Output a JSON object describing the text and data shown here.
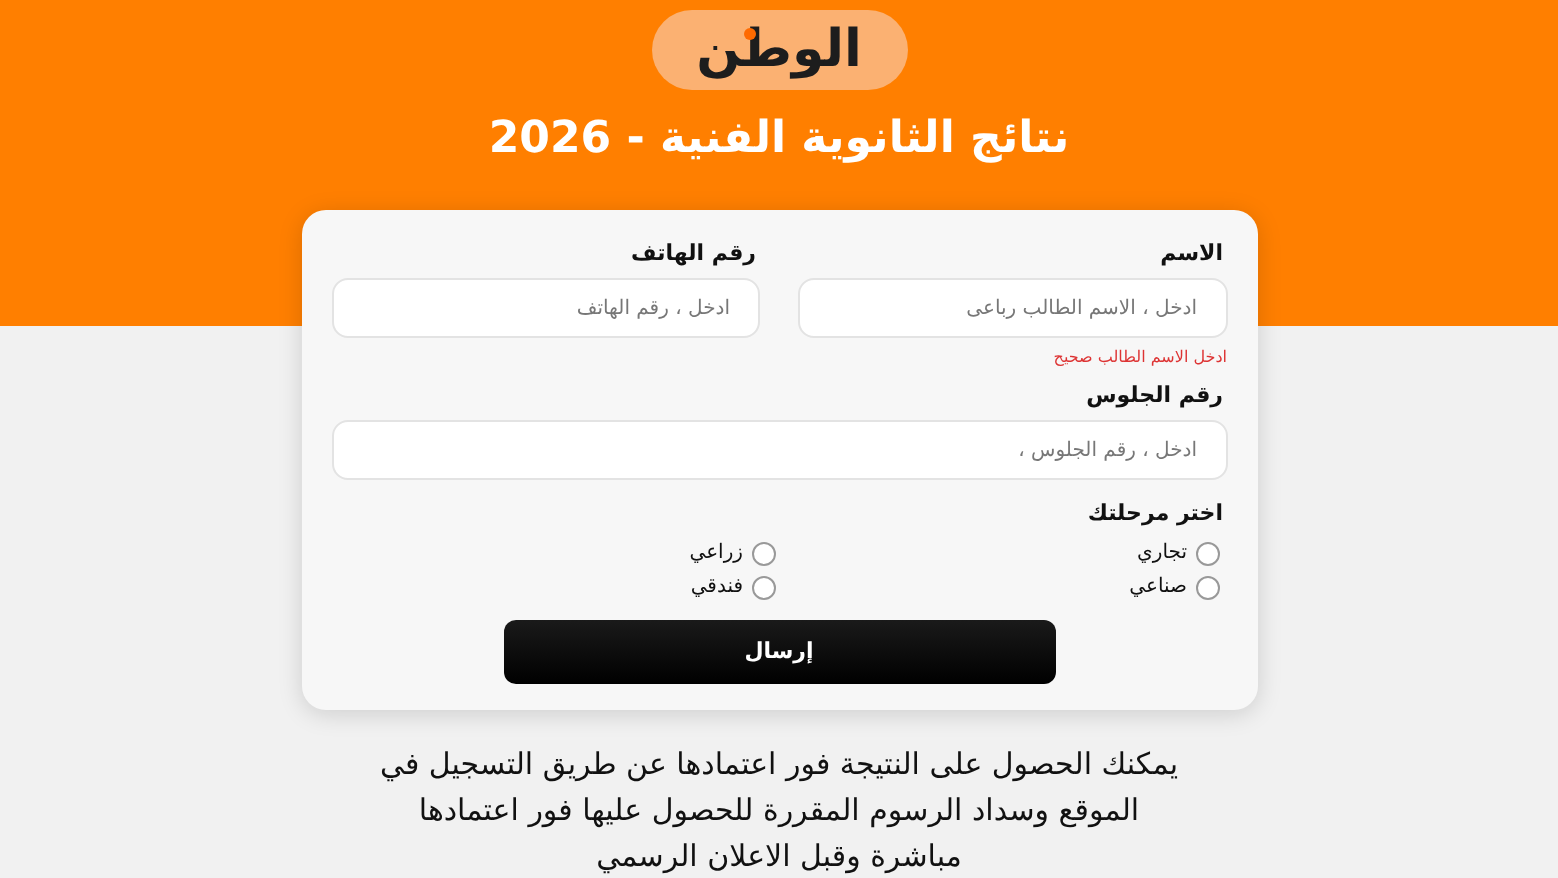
{
  "logo": {
    "text": "الوطن"
  },
  "title": "نتائج الثانوية الفنية - 2026",
  "form": {
    "fields": [
      {
        "label": "الاسم",
        "placeholder": "ادخل ، الاسم الطالب رباعى",
        "error": "ادخل الاسم الطالب صحيح"
      },
      {
        "label": "رقم الهاتف",
        "placeholder": "ادخل ، رقم الهاتف"
      }
    ],
    "seat": {
      "label": "رقم الجلوس",
      "placeholder": "ادخل ، رقم الجلوس ،"
    },
    "stage": {
      "label": "اختر مرحلتك",
      "options": [
        {
          "label": "تجاري",
          "selected": false
        },
        {
          "label": "زراعي",
          "selected": false
        },
        {
          "label": "صناعي",
          "selected": false
        },
        {
          "label": "فندقي",
          "selected": false
        }
      ]
    },
    "submit": "إرسال"
  },
  "note_lines": [
    "يمكنك الحصول على النتيجة فور اعتمادها  عن طريق التسجيل في",
    "الموقع وسداد الرسوم المقررة للحصول  عليها فور اعتمادها",
    "مباشرة وقبل الاعلان الرسمي"
  ]
}
